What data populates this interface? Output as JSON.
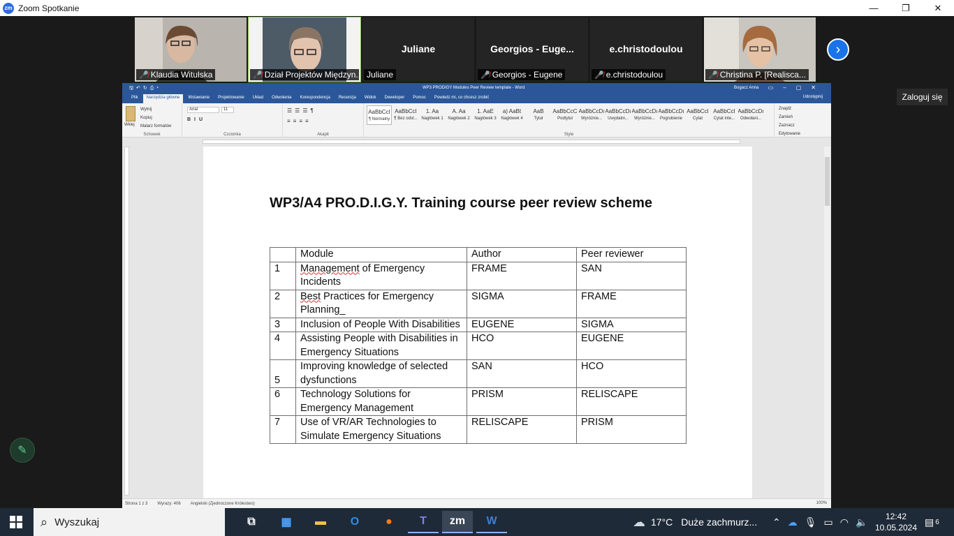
{
  "zoom": {
    "title": "Zoom Spotkanie",
    "logo": "zm",
    "window_controls": [
      "—",
      "❐",
      "✕"
    ],
    "login_button": "Zaloguj się"
  },
  "participants": [
    {
      "label": "Klaudia Witulska",
      "muted": true,
      "video": true
    },
    {
      "label": "Dział Projektów Międzyn...",
      "muted": true,
      "video": true,
      "active_speaker": true
    },
    {
      "label": "Juliane",
      "big_name": "Juliane",
      "muted": false,
      "video": false
    },
    {
      "label": "Georgios - Eugene",
      "big_name": "Georgios - Euge...",
      "muted": true,
      "video": false
    },
    {
      "label": "e.christodoulou",
      "big_name": "e.christodoulou",
      "muted": true,
      "video": false
    },
    {
      "label": "Christina P. [Realisca...",
      "muted": true,
      "video": true
    }
  ],
  "word": {
    "title": "WP3 PRODIGY Modules Peer Review template - Word",
    "user": "Bogacz Anna",
    "share": "Udostępnij",
    "tabs": [
      "Plik",
      "Narzędzia główne",
      "Wstawianie",
      "Projektowanie",
      "Układ",
      "Odwołania",
      "Korespondencja",
      "Recenzja",
      "Widok",
      "Deweloper",
      "Pomoc",
      "Powiedz mi, co chcesz zrobić"
    ],
    "clipboard": {
      "paste": "Wklej",
      "cut": "Wytnij",
      "copy": "Kopiuj",
      "painter": "Malarz formatów",
      "group": "Schowek"
    },
    "font": {
      "name": "Arial",
      "size": "11",
      "group": "Czcionka"
    },
    "paragraph_group": "Akapit",
    "styles_group": "Style",
    "styles": [
      {
        "preview": "AaBbCcI",
        "name": "¶ Normalny"
      },
      {
        "preview": "AaBbCcI",
        "name": "¶ Bez odst..."
      },
      {
        "preview": "1. Aa",
        "name": "Nagłówek 1"
      },
      {
        "preview": "A. Aa",
        "name": "Nagłówek 2"
      },
      {
        "preview": "1. AaE",
        "name": "Nagłówek 3"
      },
      {
        "preview": "a) AaBt",
        "name": "Nagłówek 4"
      },
      {
        "preview": "AaB",
        "name": "Tytuł"
      },
      {
        "preview": "AaBbCcC",
        "name": "Podtytuł"
      },
      {
        "preview": "AaBbCcDı",
        "name": "Wyróżnie..."
      },
      {
        "preview": "AaBbCcDı",
        "name": "Uwydatni..."
      },
      {
        "preview": "AaBbCcDı",
        "name": "Wyróżnie..."
      },
      {
        "preview": "AaBbCcDı",
        "name": "Pogrubienie"
      },
      {
        "preview": "AaBbCcI",
        "name": "Cytat"
      },
      {
        "preview": "AaBbCcI",
        "name": "Cytat inte..."
      },
      {
        "preview": "AaBbCcDı",
        "name": "Odwołani..."
      }
    ],
    "editing": {
      "find": "Znajdź",
      "replace": "Zamień",
      "select": "Zaznacz",
      "group": "Edytowanie"
    },
    "status": {
      "page": "Strona 1 z 3",
      "words": "Wyrazy: 406",
      "language": "Angielski (Zjednoczone Królestwo)",
      "zoom": "100%"
    }
  },
  "document": {
    "title": "WP3/A4 PRO.D.I.G.Y. Training course peer review scheme",
    "headers": [
      "",
      "Module",
      "Author",
      "Peer reviewer"
    ],
    "rows": [
      {
        "num": "1",
        "module_a": "Management",
        "module_b": " of Emergency Incidents",
        "author": "FRAME",
        "reviewer": "SAN"
      },
      {
        "num": "2",
        "module_a": "Best",
        "module_b": " Practices for Emergency Planning_",
        "author": "SIGMA",
        "reviewer": "FRAME"
      },
      {
        "num": "3",
        "module_a": "",
        "module_b": "Inclusion of People With Disabilities",
        "author": "EUGENE",
        "reviewer": "SIGMA"
      },
      {
        "num": "4",
        "module_a": "",
        "module_b": "Assisting People with Disabilities in Emergency Situations",
        "author": "HCO",
        "reviewer": "EUGENE"
      },
      {
        "num": "5",
        "module_a": "",
        "module_b": "Improving knowledge of selected dysfunctions",
        "author": "SAN",
        "reviewer": "HCO"
      },
      {
        "num": "6",
        "module_a": "",
        "module_b": "Technology Solutions for Emergency Management",
        "author": "PRISM",
        "reviewer": "RELISCAPE"
      },
      {
        "num": "7",
        "module_a": "",
        "module_b": "Use of VR/AR Technologies to Simulate Emergency Situations",
        "author": "RELISCAPE",
        "reviewer": "PRISM"
      }
    ]
  },
  "taskbar": {
    "search": "Wyszukaj",
    "weather_temp": "17°C",
    "weather_text": "Duże zachmurz...",
    "weather_badge": "1",
    "time": "12:42",
    "date": "10.05.2024",
    "notifications": "6"
  }
}
